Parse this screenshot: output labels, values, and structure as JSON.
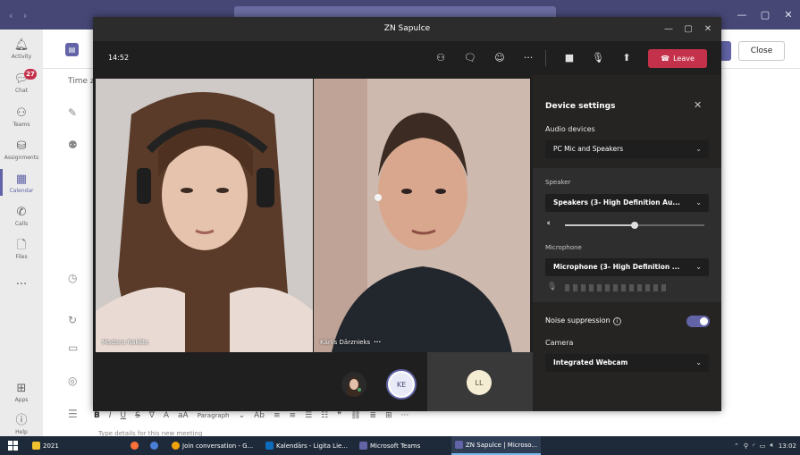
{
  "teams": {
    "rail": [
      {
        "icon": "bell",
        "label": "Activity"
      },
      {
        "icon": "chat",
        "label": "Chat",
        "badge": "27"
      },
      {
        "icon": "teams",
        "label": "Teams"
      },
      {
        "icon": "assignments",
        "label": "Assignments"
      },
      {
        "icon": "calendar",
        "label": "Calendar",
        "active": true
      },
      {
        "icon": "phone",
        "label": "Calls"
      },
      {
        "icon": "file",
        "label": "Files"
      },
      {
        "icon": "more",
        "label": "..."
      },
      {
        "icon": "apps",
        "label": "Apps"
      },
      {
        "icon": "help",
        "label": "Help"
      }
    ],
    "close_label": "Close",
    "time_zone_label": "Time z",
    "editor": {
      "bold": "B",
      "italic": "I",
      "underline": "U",
      "strike": "S",
      "paragraph": "Paragraph",
      "more": "···",
      "hint": "Type details for this new meeting"
    }
  },
  "meeting": {
    "title": "ZN Sapulce",
    "call_time": "14:52",
    "leave_label": "Leave",
    "participants": [
      {
        "name": "Madara Rakšte"
      },
      {
        "name": "Kārlis Dārznieks",
        "more": "···"
      }
    ],
    "avatars": {
      "ke": "KE",
      "ll": "LL"
    }
  },
  "device_settings": {
    "title": "Device settings",
    "audio_devices_label": "Audio devices",
    "audio_device_value": "PC Mic and Speakers",
    "speaker_label": "Speaker",
    "speaker_value": "Speakers (3- High Definition Au...",
    "speaker_volume": 0.5,
    "microphone_label": "Microphone",
    "microphone_value": "Microphone (3- High Definition ...",
    "noise_suppression_label": "Noise suppression",
    "noise_suppression_on": true,
    "camera_label": "Camera",
    "camera_value": "Integrated Webcam"
  },
  "taskbar": {
    "items": [
      {
        "label": "2021",
        "color": "#f2c12e"
      },
      {
        "label": "",
        "color": "#ff7139"
      },
      {
        "label": "",
        "color": "#4a7fd6"
      },
      {
        "label": "Join conversation - G...",
        "color": "#f0a30a"
      },
      {
        "label": "Kalendārs - Ligita Lie...",
        "color": "#0f6cbd"
      },
      {
        "label": "Microsoft Teams",
        "color": "#6264a7"
      },
      {
        "label": "ZN Sapulce | Microso...",
        "color": "#6264a7",
        "active": true
      }
    ],
    "clock": "13:02"
  }
}
